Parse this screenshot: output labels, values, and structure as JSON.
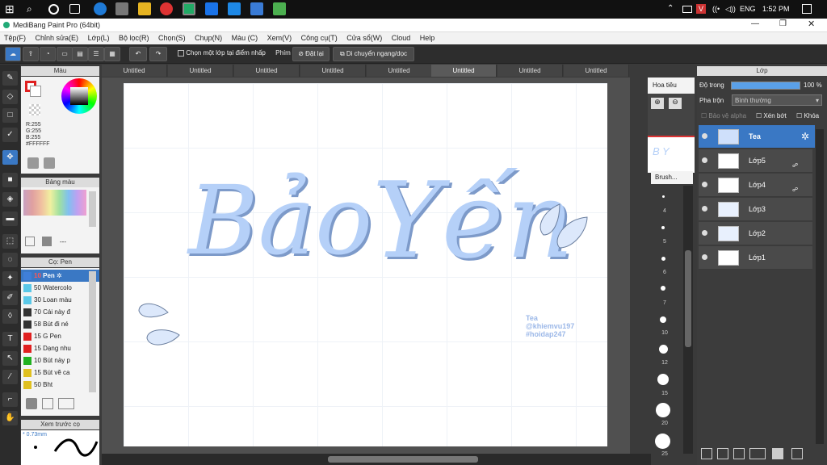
{
  "taskbar": {
    "lang": "ENG",
    "time": "1:52 PM"
  },
  "window": {
    "title": "MediBang Paint Pro (64bit)"
  },
  "menu": [
    "Tệp(F)",
    "Chỉnh sửa(E)",
    "Lớp(L)",
    "Bộ lọc(R)",
    "Chọn(S)",
    "Chụp(N)",
    "Màu (C)",
    "Xem(V)",
    "Công cụ(T)",
    "Cửa sổ(W)",
    "Cloud",
    "Help"
  ],
  "toolbar": {
    "select_layer": "Chọn một lớp tại điểm nhấp",
    "phim": "Phím",
    "reset": "Đặt lại",
    "move": "Di chuyển ngang/dọc"
  },
  "color_panel": {
    "title": "Màu",
    "r": "R:255",
    "g": "G:255",
    "b": "B:255",
    "hex": "#FFFFFF"
  },
  "palette_panel": {
    "title": "Bảng màu",
    "dash": "---"
  },
  "brush_panel": {
    "title": "Cọ: Pen",
    "items": [
      {
        "size": "10",
        "name": "Pen",
        "color": "#3f7fd8"
      },
      {
        "size": "50",
        "name": "Watercolo",
        "color": "#5ac8e8"
      },
      {
        "size": "30",
        "name": "Loan màu",
        "color": "#5ac8e8"
      },
      {
        "size": "70",
        "name": "Cái này đ",
        "color": "#333333"
      },
      {
        "size": "58",
        "name": "Bút đi né",
        "color": "#333333"
      },
      {
        "size": "15",
        "name": "G Pen",
        "color": "#e02020"
      },
      {
        "size": "15",
        "name": "Dạng nhu",
        "color": "#e02020"
      },
      {
        "size": "10",
        "name": "Bút này p",
        "color": "#20b020"
      },
      {
        "size": "15",
        "name": "Bút vẽ ca",
        "color": "#e0c020"
      },
      {
        "size": "50",
        "name": "Bht",
        "color": "#e0c020"
      }
    ]
  },
  "preview_panel": {
    "title": "Xem trước cọ",
    "size": "0.73mm"
  },
  "tabs": [
    "Untitled",
    "Untitled",
    "Untitled",
    "Untitled",
    "Untitled",
    "Untitled",
    "Untitled",
    "Untitled"
  ],
  "artwork": {
    "line1": "Bảo",
    "line2": "Yến",
    "credit1": "Tea",
    "credit2": "@khiemvu197",
    "credit3": "#hoidap247"
  },
  "navigator": {
    "label": "Hoa tiêu",
    "brush_label": "Brush..."
  },
  "brush_sizes": [
    "4",
    "5",
    "6",
    "7",
    "10",
    "12",
    "15",
    "20",
    "25",
    "30"
  ],
  "layer_panel": {
    "title": "Lớp",
    "opacity_label": "Độ trong",
    "opacity_value": "100 %",
    "blend_label": "Pha trộn",
    "blend_value": "Bình thường",
    "alpha": "Bảo vệ alpha",
    "clip": "Xén bớt",
    "lock": "Khóa",
    "layers": [
      {
        "name": "Tea"
      },
      {
        "name": "Lớp5"
      },
      {
        "name": "Lớp4"
      },
      {
        "name": "Lớp3"
      },
      {
        "name": "Lớp2"
      },
      {
        "name": "Lớp1"
      }
    ]
  }
}
